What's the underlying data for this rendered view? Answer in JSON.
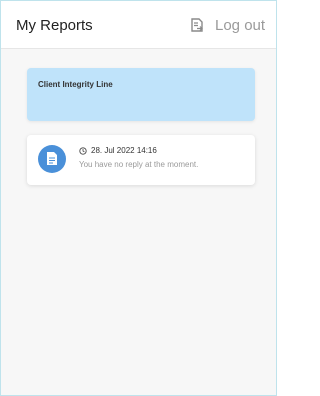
{
  "header": {
    "title": "My Reports",
    "logout_label": "Log out"
  },
  "reports_section": {
    "title": "Client Integrity Line"
  },
  "messages": [
    {
      "timestamp": "28. Jul 2022 14:16",
      "text": "You have no reply at the moment."
    }
  ],
  "colors": {
    "accent": "#4a90d9",
    "section_background": "#bfe3fa",
    "muted_text": "#9a9a9a"
  },
  "icons": [
    "logout-icon",
    "document-icon",
    "clock-icon"
  ]
}
